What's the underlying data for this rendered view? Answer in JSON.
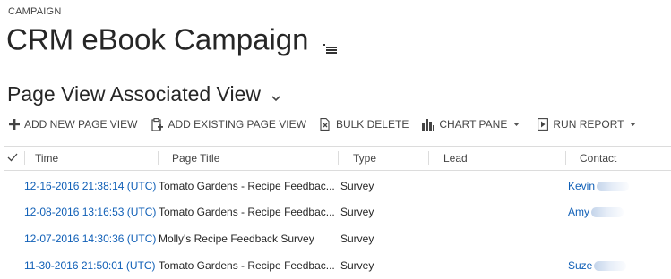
{
  "header": {
    "entity_label": "CAMPAIGN",
    "record_title": "CRM eBook Campaign",
    "view_title": "Page View Associated View"
  },
  "commands": [
    {
      "label": "ADD NEW PAGE VIEW",
      "icon": "plus-icon"
    },
    {
      "label": "ADD EXISTING PAGE VIEW",
      "icon": "add-existing-icon"
    },
    {
      "label": "BULK DELETE",
      "icon": "bulk-delete-icon"
    },
    {
      "label": "CHART PANE",
      "icon": "chart-icon"
    },
    {
      "label": "RUN REPORT",
      "icon": "report-icon"
    }
  ],
  "grid": {
    "columns": [
      "Time",
      "Page Title",
      "Type",
      "Lead",
      "Contact"
    ],
    "rows": [
      {
        "time": "12-16-2016 21:38:14 (UTC)",
        "page_title": "Tomato Gardens - Recipe Feedbac...",
        "type": "Survey",
        "lead": "",
        "contact": "Kevin"
      },
      {
        "time": "12-08-2016 13:16:53 (UTC)",
        "page_title": "Tomato Gardens - Recipe Feedbac...",
        "type": "Survey",
        "lead": "",
        "contact": "Amy"
      },
      {
        "time": "12-07-2016 14:30:36 (UTC)",
        "page_title": "Molly's Recipe Feedback Survey",
        "type": "Survey",
        "lead": "",
        "contact": ""
      },
      {
        "time": "11-30-2016 21:50:01 (UTC)",
        "page_title": "Tomato Gardens - Recipe Feedbac...",
        "type": "Survey",
        "lead": "",
        "contact": "Suze"
      }
    ]
  },
  "colors": {
    "link": "#1160b7",
    "text": "#262626",
    "border": "#dcdcdc"
  }
}
